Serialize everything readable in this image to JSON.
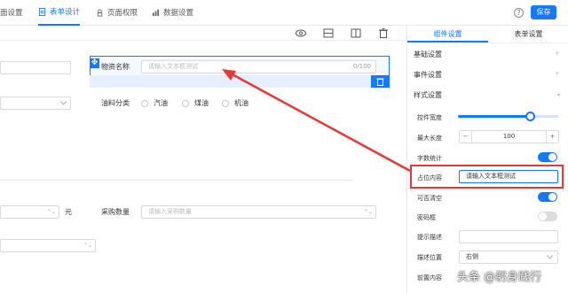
{
  "nav": {
    "tabs": [
      {
        "label": "面设置"
      },
      {
        "label": "表单设计"
      },
      {
        "label": "页面权限"
      },
      {
        "label": "数据设置"
      }
    ],
    "help": "?",
    "save_label": "保存"
  },
  "canvas": {
    "field_material_name": {
      "label": "物资名称",
      "placeholder": "请输入文本框测试",
      "counter": "0/100"
    },
    "fuel_type": {
      "label": "油料分类",
      "options": [
        "汽油",
        "煤油",
        "机油"
      ]
    },
    "unit_suffix": "元",
    "purchase_qty": {
      "label": "采购数量",
      "placeholder": "请输入采购数量"
    }
  },
  "panel": {
    "tabs": [
      "组件设置",
      "表单设置"
    ],
    "sections": {
      "basic": "基础设置",
      "events": "事件设置",
      "style": "样式设置"
    },
    "props": {
      "width": "控件宽度",
      "width_level": 0.72,
      "maxlen": "最大长度",
      "maxlen_value": "100",
      "minus": "−",
      "plus": "+",
      "char_count": "字数统计",
      "placeholder_label": "占位内容",
      "placeholder_value": "请输入文本框测试",
      "clearable": "可否清空",
      "password": "密码框",
      "hint": "提示描述",
      "hint_pos": "描述位置",
      "hint_pos_value": "右侧",
      "prefix": "前置内容"
    }
  },
  "watermark": "头条 @躬身践行",
  "colors": {
    "accent": "#1677ff",
    "annotation": "#e53935"
  }
}
